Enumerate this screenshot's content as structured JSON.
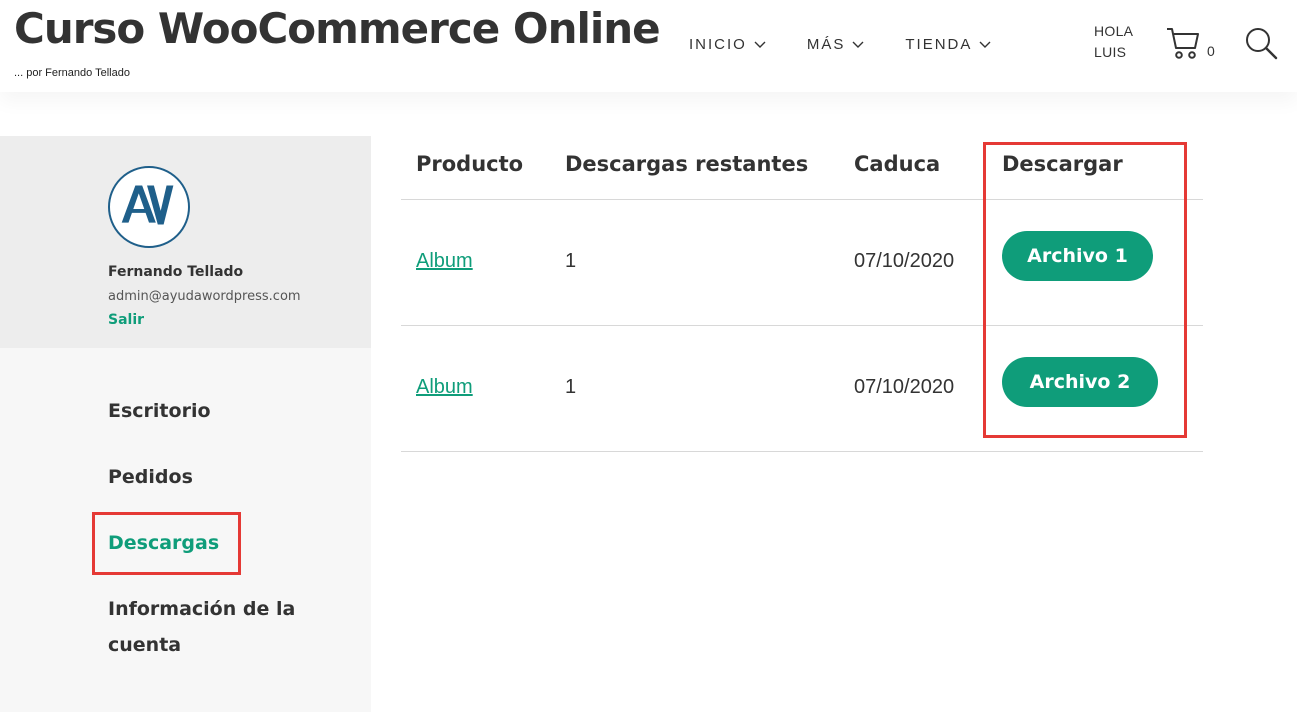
{
  "header": {
    "site_title": "Curso WooCommerce Online",
    "tagline": "... por Fernando Tellado",
    "nav": [
      {
        "label": "INICIO"
      },
      {
        "label": "MÁS"
      },
      {
        "label": "TIENDA"
      }
    ],
    "greeting_line1": "HOLA",
    "greeting_line2": "LUIS",
    "cart_count": "0"
  },
  "sidebar": {
    "user_name": "Fernando Tellado",
    "user_email": "admin@ayudawordpress.com",
    "logout_label": "Salir",
    "menu": [
      {
        "label": "Escritorio"
      },
      {
        "label": "Pedidos"
      },
      {
        "label": "Descargas",
        "active": true
      },
      {
        "label_line1": "Información de la",
        "label_line2": "cuenta"
      }
    ]
  },
  "downloads": {
    "headers": {
      "product": "Producto",
      "remaining": "Descargas restantes",
      "expires": "Caduca",
      "download": "Descargar"
    },
    "rows": [
      {
        "product": "Album",
        "remaining": "1",
        "expires": "07/10/2020",
        "file_label": "Archivo 1"
      },
      {
        "product": "Album",
        "remaining": "1",
        "expires": "07/10/2020",
        "file_label": "Archivo 2"
      }
    ]
  },
  "colors": {
    "accent": "#0f9d7a",
    "highlight_box": "#e53935",
    "sidebar_bg": "#f7f7f7",
    "profile_bg": "#ededed"
  }
}
